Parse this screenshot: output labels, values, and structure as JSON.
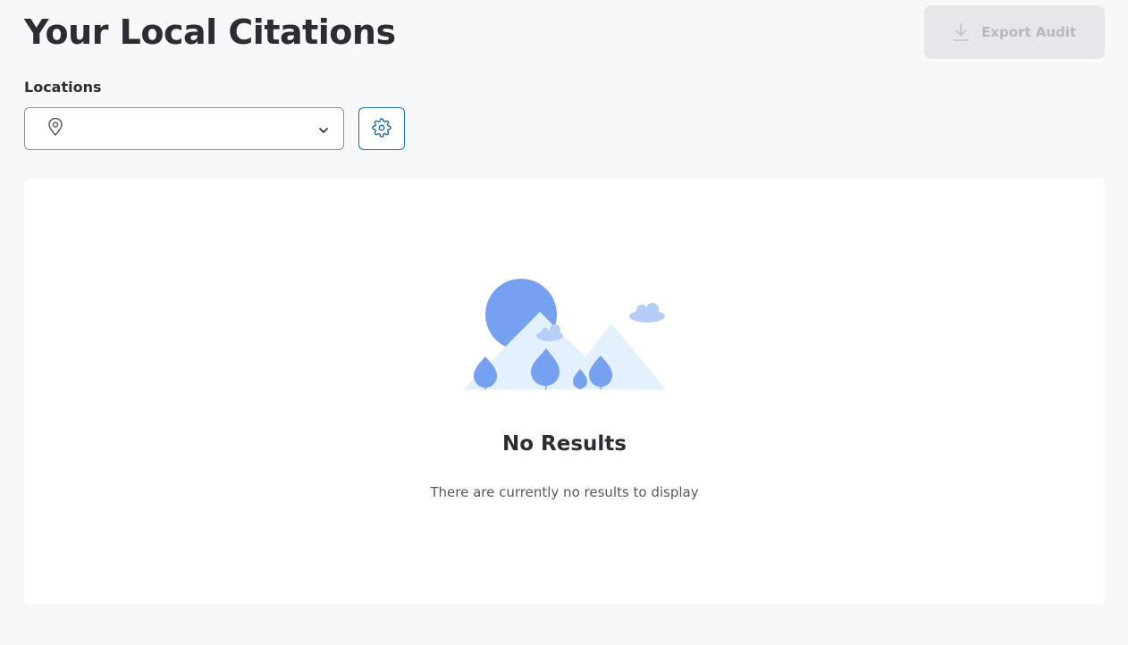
{
  "header": {
    "title": "Your Local Citations",
    "export_label": "Export Audit",
    "export_icon": "download-icon"
  },
  "filters": {
    "locations_label": "Locations",
    "location_value": "",
    "location_icon": "map-pin-icon",
    "dropdown_icon": "chevron-down-icon",
    "settings_icon": "gear-icon"
  },
  "results": {
    "empty_title": "No Results",
    "empty_message": "There are currently no results to display",
    "illustration": "mountains-trees-illustration"
  },
  "colors": {
    "background": "#f7f8fa",
    "accent": "#1d6fb0",
    "illustration_primary": "#76a0f0",
    "illustration_light": "#e3f0fd",
    "disabled_bg": "#e6e7ea"
  }
}
